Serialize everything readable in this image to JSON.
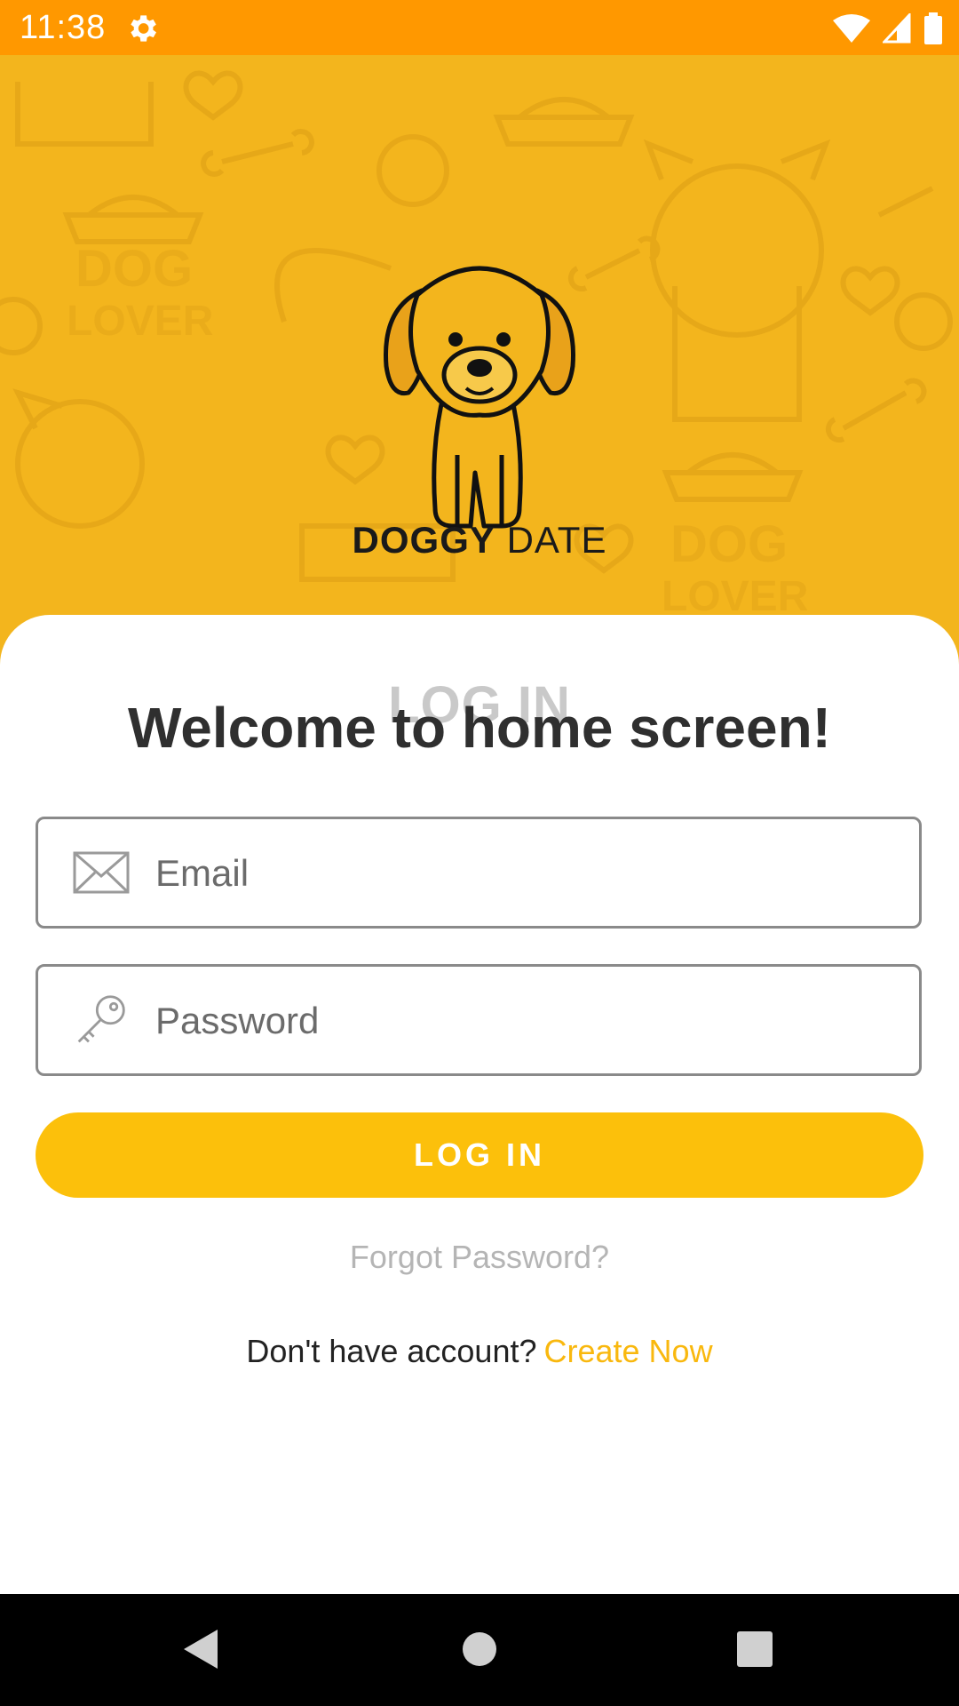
{
  "status_bar": {
    "time": "11:38",
    "icons": [
      "settings-icon",
      "wifi-icon",
      "signal-icon",
      "battery-icon"
    ],
    "background": "#FF9800"
  },
  "hero": {
    "background": "#F3B51D",
    "brand_bold": "DOGGY",
    "brand_regular": "DATE"
  },
  "login": {
    "ghost_title": "LOG IN",
    "welcome": "Welcome to home screen!",
    "email_placeholder": "Email",
    "password_placeholder": "Password",
    "login_button": "LOG IN",
    "forgot_password": "Forgot Password?",
    "no_account": "Don't have account?",
    "create_now": "Create Now",
    "accent": "#FCC00B"
  },
  "nav_bar": {
    "icons": [
      "back-icon",
      "home-icon",
      "recents-icon"
    ]
  }
}
